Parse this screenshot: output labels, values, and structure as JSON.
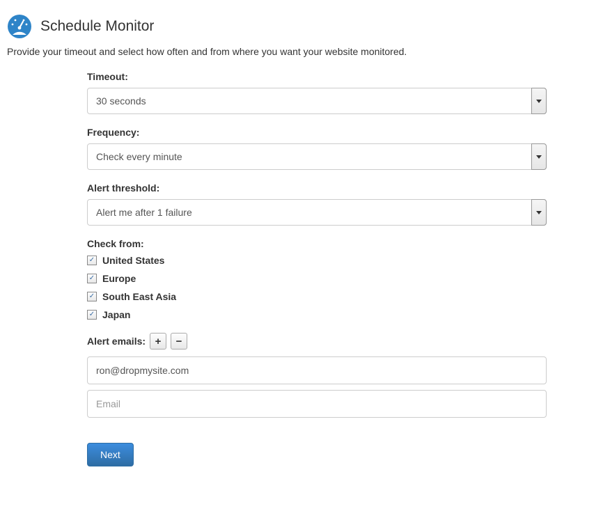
{
  "header": {
    "title": "Schedule Monitor",
    "description": "Provide your timeout and select how often and from where you want your website monitored."
  },
  "form": {
    "timeout": {
      "label": "Timeout:",
      "value": "30 seconds"
    },
    "frequency": {
      "label": "Frequency:",
      "value": "Check every minute"
    },
    "alert_threshold": {
      "label": "Alert threshold:",
      "value": "Alert me after 1 failure"
    },
    "check_from": {
      "label": "Check from:",
      "options": [
        {
          "label": "United States",
          "checked": true
        },
        {
          "label": "Europe",
          "checked": true
        },
        {
          "label": "South East Asia",
          "checked": true
        },
        {
          "label": "Japan",
          "checked": true
        }
      ]
    },
    "alert_emails": {
      "label": "Alert emails:",
      "add_icon": "+",
      "remove_icon": "−",
      "emails": [
        {
          "value": "ron@dropmysite.com",
          "placeholder": "Email"
        },
        {
          "value": "",
          "placeholder": "Email"
        }
      ]
    },
    "next_label": "Next"
  }
}
